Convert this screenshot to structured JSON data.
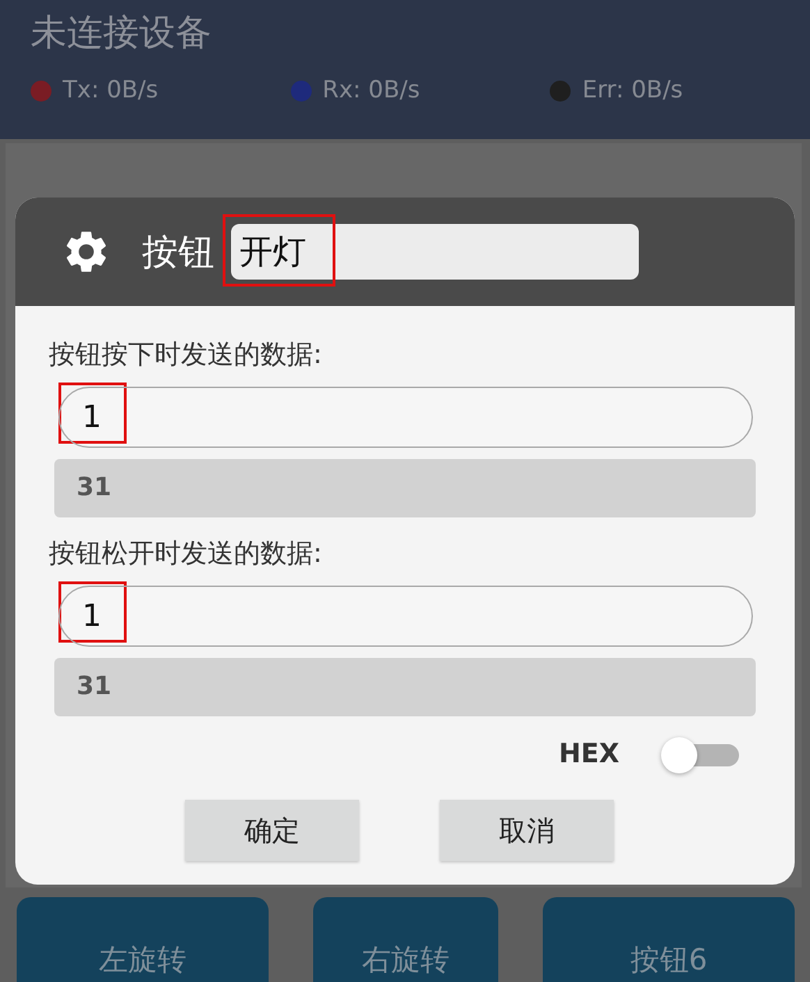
{
  "app": {
    "title": "未连接设备",
    "stats": [
      {
        "label": "Tx: 0B/s",
        "color": "#7a1c24"
      },
      {
        "label": "Rx: 0B/s",
        "color": "#1e2a7c"
      },
      {
        "label": "Err: 0B/s",
        "color": "#1f1f1f"
      }
    ],
    "pad_buttons": [
      "左旋转",
      "右旋转",
      "按钮6"
    ]
  },
  "dialog": {
    "title": "按钮",
    "name": {
      "value": "开灯",
      "highlighted": true
    },
    "sections": [
      {
        "label": "按钮按下时发送的数据:",
        "value": "1",
        "highlighted": true,
        "hex": "31"
      },
      {
        "label": "按钮松开时发送的数据:",
        "value": "1",
        "highlighted": true,
        "hex": "31"
      }
    ],
    "hex_toggle": {
      "label": "HEX",
      "on": false
    },
    "buttons": [
      "确定",
      "取消"
    ]
  }
}
